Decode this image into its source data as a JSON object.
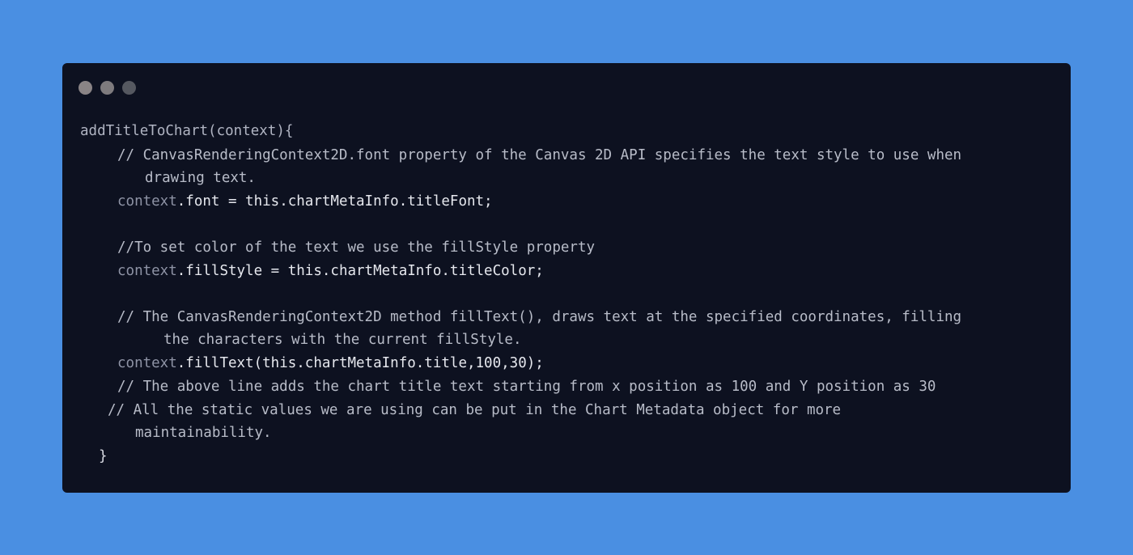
{
  "window": {
    "controls": [
      "close",
      "minimize",
      "maximize"
    ]
  },
  "code": {
    "l1_fn": "addTitleToChart",
    "l1_rest": "(context){",
    "l2": "// CanvasRenderingContext2D.font property of the Canvas 2D API specifies the text style to use when",
    "l3": "drawing text.",
    "l4_obj": "context",
    "l4_rest": ".font = this.chartMetaInfo.titleFont;",
    "l6": "//To set color of the text we use the fillStyle property",
    "l7_obj": "context",
    "l7_rest": ".fillStyle = this.chartMetaInfo.titleColor;",
    "l9": "// The CanvasRenderingContext2D method fillText(), draws text at the specified coordinates, filling",
    "l10": "the characters with the current fillStyle.",
    "l11_obj": "context",
    "l11_rest": ".fillText(this.chartMetaInfo.title,100,30);",
    "l12": "// The above line adds the chart title text starting from x position as 100 and Y position as 30",
    "l13": "// All the static values we are using can be put in the Chart Metadata object for more",
    "l14": "maintainability.",
    "l15": "}"
  }
}
